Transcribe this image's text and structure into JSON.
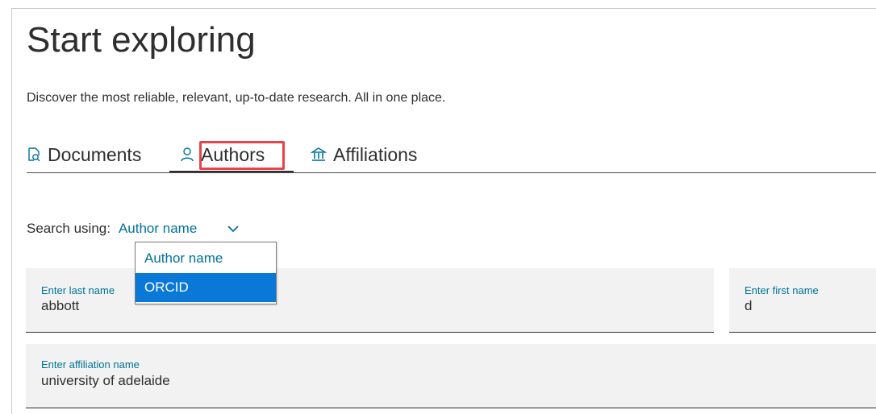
{
  "header": {
    "title": "Start exploring",
    "subtitle": "Discover the most reliable, relevant, up-to-date research. All in one place."
  },
  "tabs": [
    {
      "label": "Documents",
      "icon": "document-search-icon",
      "active": false
    },
    {
      "label": "Authors",
      "icon": "person-icon",
      "active": true
    },
    {
      "label": "Affiliations",
      "icon": "institution-icon",
      "active": false
    }
  ],
  "search_using": {
    "label": "Search using:",
    "selected": "Author name",
    "options": [
      "Author name",
      "ORCID"
    ],
    "highlighted_option": "ORCID"
  },
  "fields": {
    "last_name": {
      "label": "Enter last name",
      "value": "abbott"
    },
    "first_name": {
      "label": "Enter first name",
      "value": "d"
    },
    "affiliation": {
      "label": "Enter affiliation name",
      "value": "university of adelaide"
    }
  },
  "colors": {
    "accent": "#007398",
    "highlight_option": "#0a78d7",
    "annotation_box": "#e8434a",
    "field_background": "#f2f2f2"
  }
}
